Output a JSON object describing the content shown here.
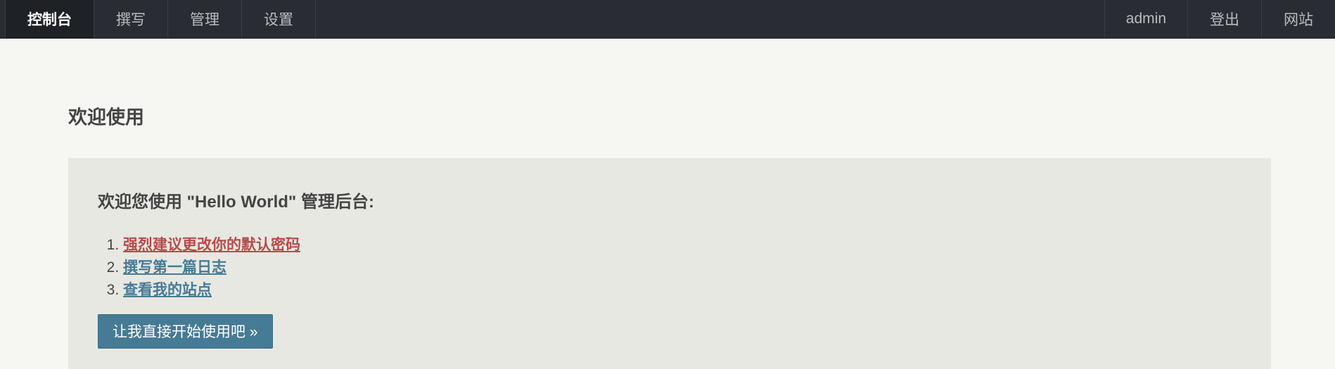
{
  "nav": {
    "left": [
      {
        "label": "控制台",
        "active": true
      },
      {
        "label": "撰写",
        "active": false
      },
      {
        "label": "管理",
        "active": false
      },
      {
        "label": "设置",
        "active": false
      }
    ],
    "right": [
      {
        "label": "admin"
      },
      {
        "label": "登出"
      },
      {
        "label": "网站"
      }
    ]
  },
  "main": {
    "title": "欢迎使用",
    "board": {
      "heading": "欢迎您使用 \"Hello World\" 管理后台:",
      "items": [
        {
          "label": "强烈建议更改你的默认密码",
          "status": "warning"
        },
        {
          "label": "撰写第一篇日志",
          "status": "normal"
        },
        {
          "label": "查看我的站点",
          "status": "normal"
        }
      ],
      "button_label": "让我直接开始使用吧 »"
    }
  },
  "colors": {
    "topbar": "#292d33",
    "active_tab": "#1e2125",
    "page_bg": "#f6f6f3",
    "board_bg": "#e8e8e3",
    "link": "#467b96",
    "warning_link": "#b94a48",
    "primary_button": "#467b96"
  }
}
